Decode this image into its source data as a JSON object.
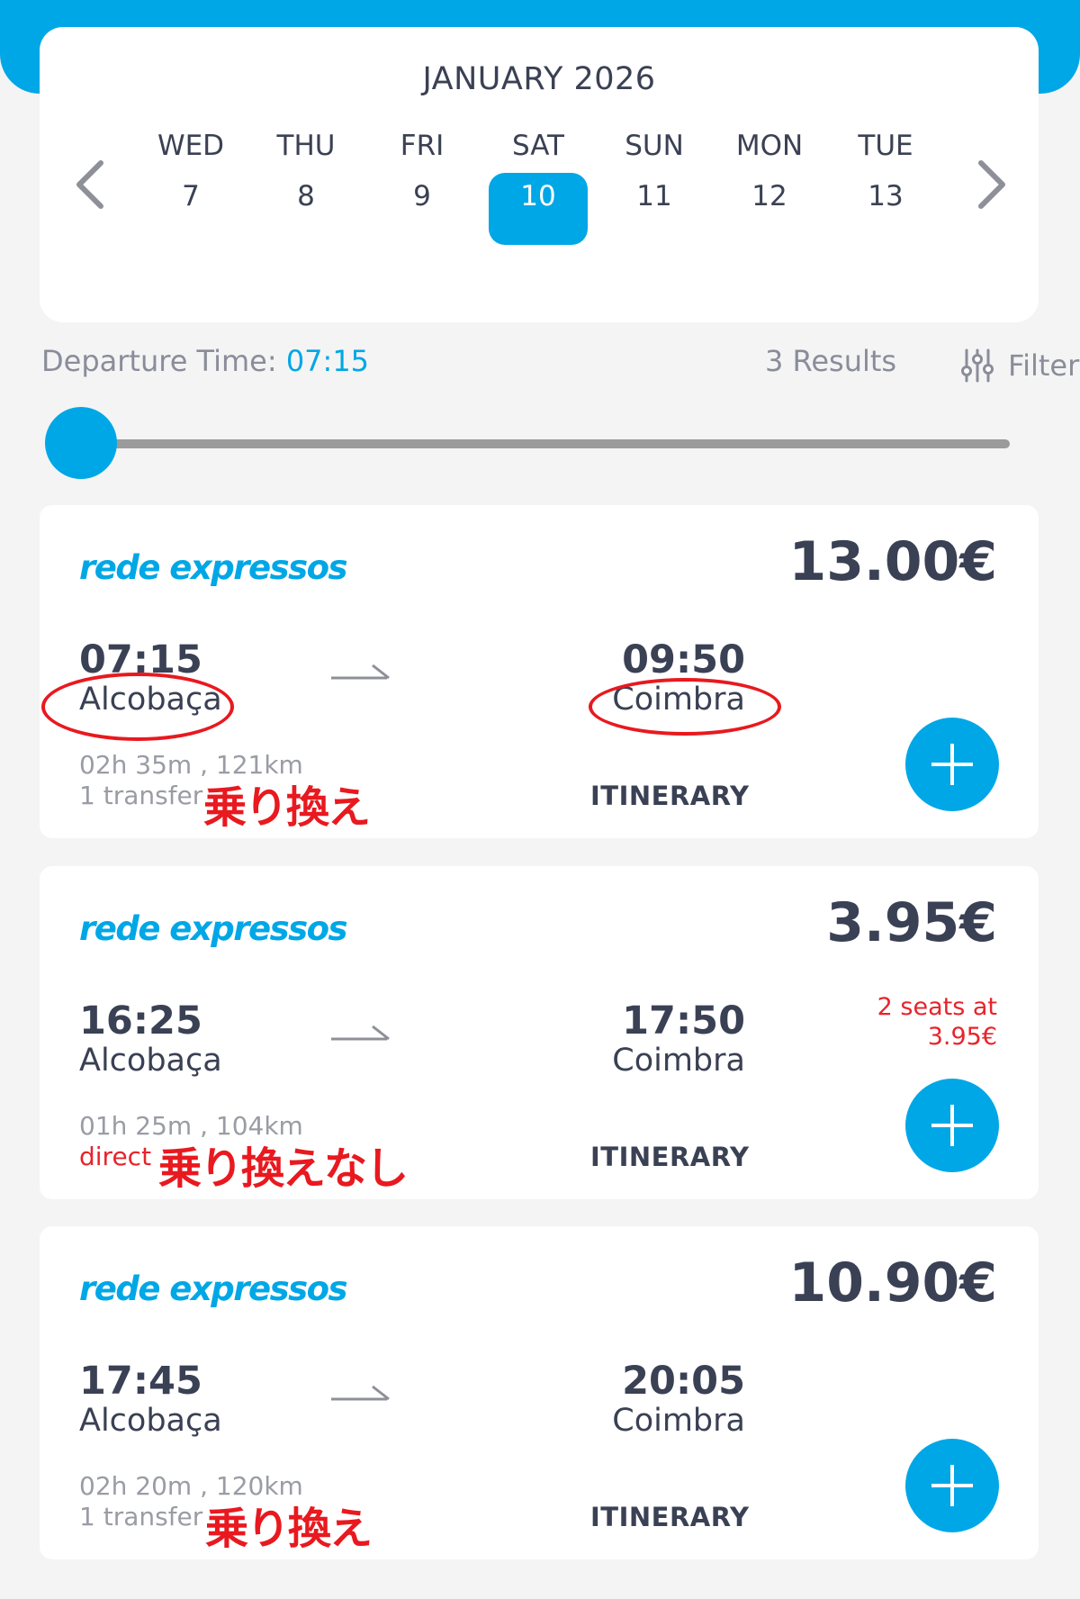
{
  "calendar": {
    "month": "JANUARY 2026",
    "days": [
      {
        "dow": "WED",
        "num": "7"
      },
      {
        "dow": "THU",
        "num": "8"
      },
      {
        "dow": "FRI",
        "num": "9"
      },
      {
        "dow": "SAT",
        "num": "10",
        "selected": true
      },
      {
        "dow": "SUN",
        "num": "11"
      },
      {
        "dow": "MON",
        "num": "12"
      },
      {
        "dow": "TUE",
        "num": "13"
      }
    ],
    "prev_icon": "chevron-left-icon",
    "next_icon": "chevron-right-icon"
  },
  "filters": {
    "departure_label": "Departure Time: ",
    "departure_value": "07:15",
    "results": "3 Results",
    "filter_label": "Filter",
    "filter_icon": "sliders-icon",
    "slider_level": 0
  },
  "trips": [
    {
      "brand": "rede expressos",
      "price": "13.00€",
      "depart_time": "07:15",
      "depart_city": "Alcobaça",
      "arrive_time": "09:50",
      "arrive_city": "Coimbra",
      "duration": "02h 35m , 121km",
      "transfer": "1 transfer",
      "note": "乗り換え",
      "itinerary": "ITINERARY",
      "seat_note_1": "",
      "seat_note_2": ""
    },
    {
      "brand": "rede expressos",
      "price": "3.95€",
      "depart_time": "16:25",
      "depart_city": "Alcobaça",
      "arrive_time": "17:50",
      "arrive_city": "Coimbra",
      "duration": "01h 25m , 104km",
      "transfer": "direct",
      "note": "乗り換えなし",
      "itinerary": "ITINERARY",
      "seat_note_1": "2 seats at",
      "seat_note_2": "3.95€"
    },
    {
      "brand": "rede expressos",
      "price": "10.90€",
      "depart_time": "17:45",
      "depart_city": "Alcobaça",
      "arrive_time": "20:05",
      "arrive_city": "Coimbra",
      "duration": "02h 20m , 120km",
      "transfer": "1 transfer",
      "note": "乗り換え",
      "itinerary": "ITINERARY",
      "seat_note_1": "",
      "seat_note_2": ""
    }
  ],
  "colors": {
    "accent": "#00a7e6",
    "text": "#3b4154",
    "muted": "#9a9ca5",
    "annotation": "#e8191f"
  }
}
